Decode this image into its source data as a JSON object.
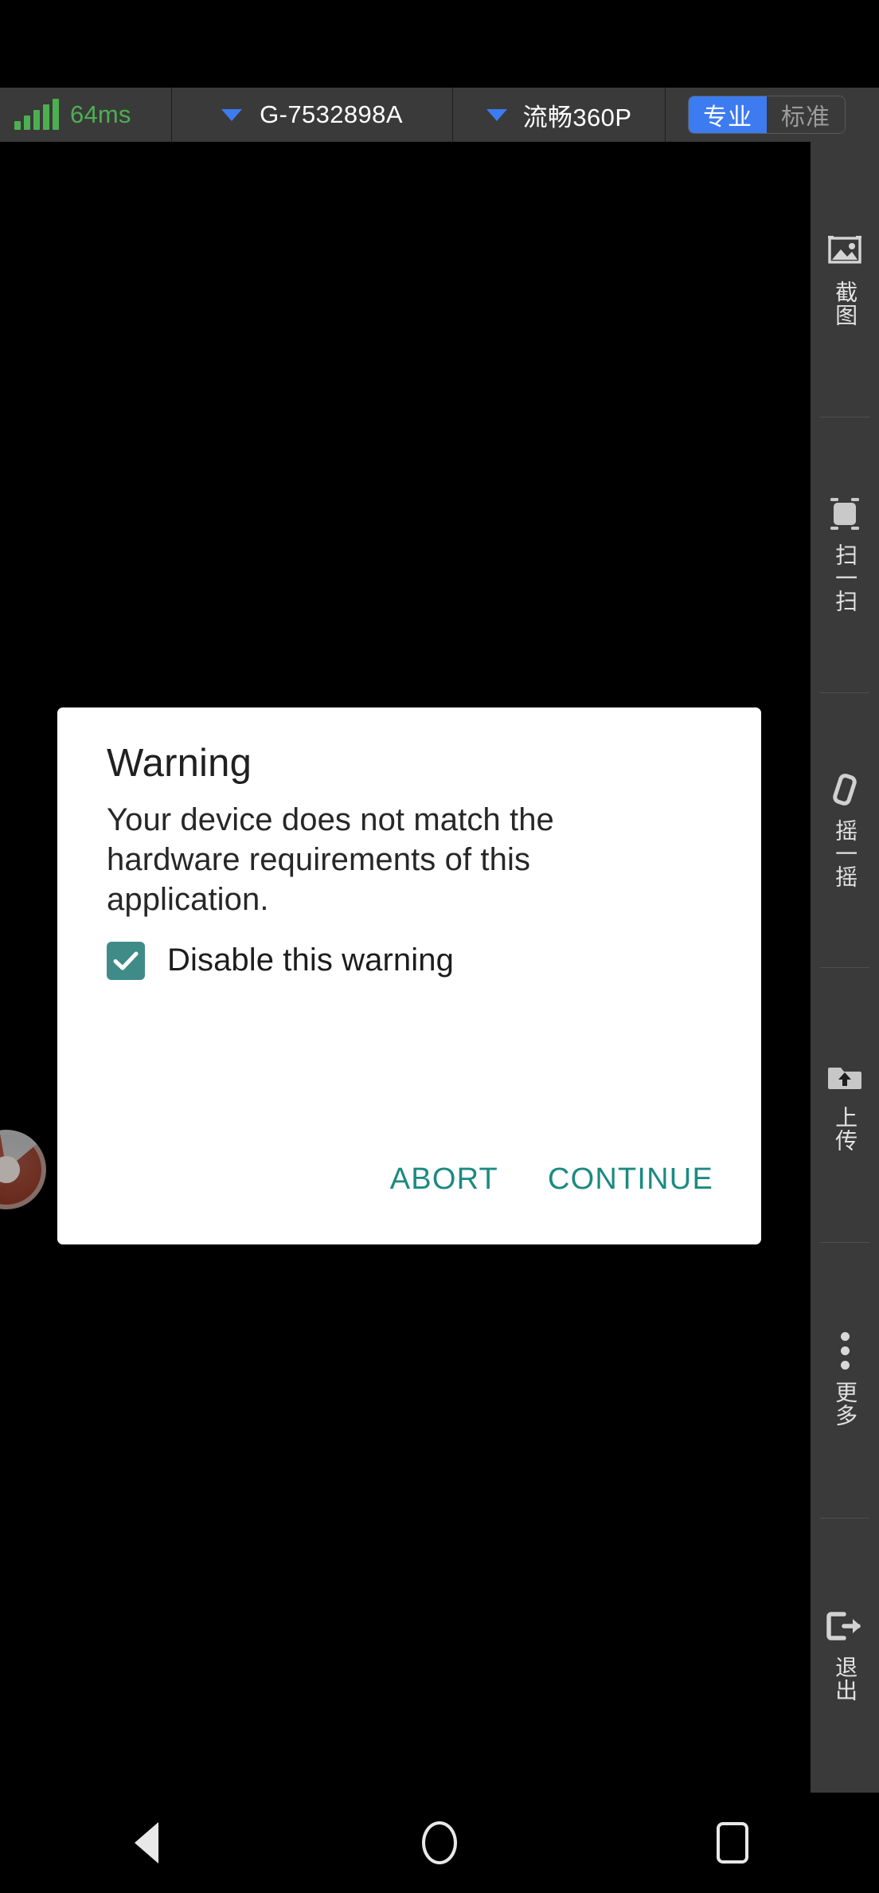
{
  "topbar": {
    "latency": {
      "icon": "signal-bars-icon",
      "value": "64ms",
      "color": "#4caf50"
    },
    "device": {
      "icon": "chevron-down-icon",
      "label": "G-7532898A"
    },
    "quality": {
      "icon": "chevron-down-icon",
      "label": "流畅360P"
    },
    "mode_segments": [
      {
        "label": "专业",
        "active": true
      },
      {
        "label": "标准",
        "active": false
      }
    ],
    "accent_color": "#3d7bf0",
    "bar_color": "#3a3a3a"
  },
  "dialog": {
    "title": "Warning",
    "message": "Your device does not match the hardware requirements of this application.",
    "checkbox": {
      "label": "Disable this warning",
      "checked": true,
      "color": "#3f8b87"
    },
    "buttons": [
      {
        "label": "ABORT",
        "name": "abort-button"
      },
      {
        "label": "CONTINUE",
        "name": "continue-button"
      }
    ],
    "button_color": "#1c8a82",
    "background": "#ffffff"
  },
  "sidebar": {
    "items": [
      {
        "label": "截图",
        "icon": "image-icon",
        "name": "sidebar-item-screenshot"
      },
      {
        "label": "扫一扫",
        "icon": "scan-frame-icon",
        "name": "sidebar-item-scan"
      },
      {
        "label": "摇一摇",
        "icon": "phone-shake-icon",
        "name": "sidebar-item-shake"
      },
      {
        "label": "上传",
        "icon": "folder-upload-icon",
        "name": "sidebar-item-upload"
      },
      {
        "label": "更多",
        "icon": "more-vertical-icon",
        "name": "sidebar-item-more"
      },
      {
        "label": "退出",
        "icon": "logout-icon",
        "name": "sidebar-item-exit"
      }
    ],
    "background": "#3a3a3a"
  },
  "navbar": {
    "buttons": [
      {
        "icon": "back-triangle-icon",
        "name": "nav-back-button"
      },
      {
        "icon": "home-circle-icon",
        "name": "nav-home-button"
      },
      {
        "icon": "recents-square-icon",
        "name": "nav-recents-button"
      }
    ]
  },
  "canvas": {
    "background": "#000000",
    "overlay": {
      "name": "joystick-puck",
      "icon": "circular-control-icon"
    }
  }
}
